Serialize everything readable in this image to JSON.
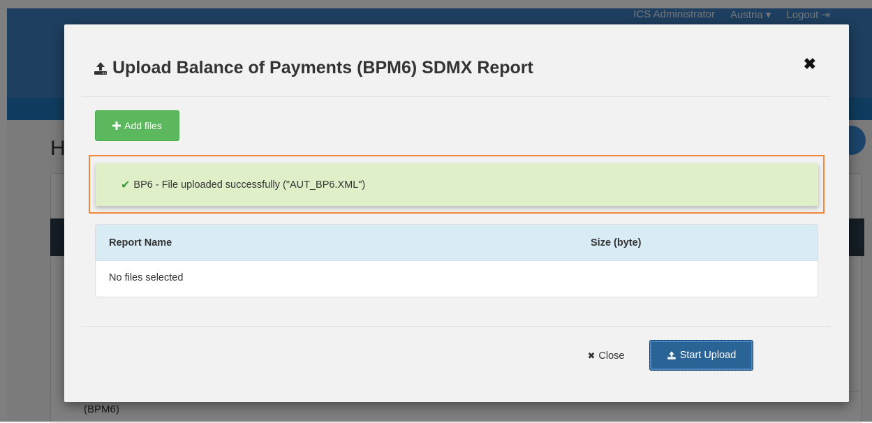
{
  "app": {
    "nav": {
      "user": "ICS Administrator",
      "country": "Austria ▾",
      "logout": "Logout"
    },
    "background": {
      "heading_partial": "H",
      "row_partial": "(BPM6)"
    }
  },
  "modal": {
    "title": "Upload Balance of Payments (BPM6) SDMX Report",
    "title_icon": "upload-icon",
    "close_icon": "close-icon",
    "add_files_label": "Add files",
    "add_files_icon": "plus-icon",
    "alert": {
      "icon": "check-icon",
      "message": "BP6 - File uploaded successfully (\"AUT_BP6.XML\")"
    },
    "table": {
      "columns": [
        "Report Name",
        "Size (byte)"
      ],
      "empty_message": "No files selected"
    },
    "footer": {
      "close_label": "Close",
      "close_icon": "close-icon",
      "upload_label": "Start Upload",
      "upload_icon": "upload-icon"
    }
  },
  "colors": {
    "header_blue": "#3d7fc0",
    "success_green": "#5cb85c",
    "alert_bg": "#dff0c8",
    "highlight_orange": "#f0873c",
    "table_header_bg": "#d9ecf6",
    "primary_blue": "#2a6496"
  }
}
